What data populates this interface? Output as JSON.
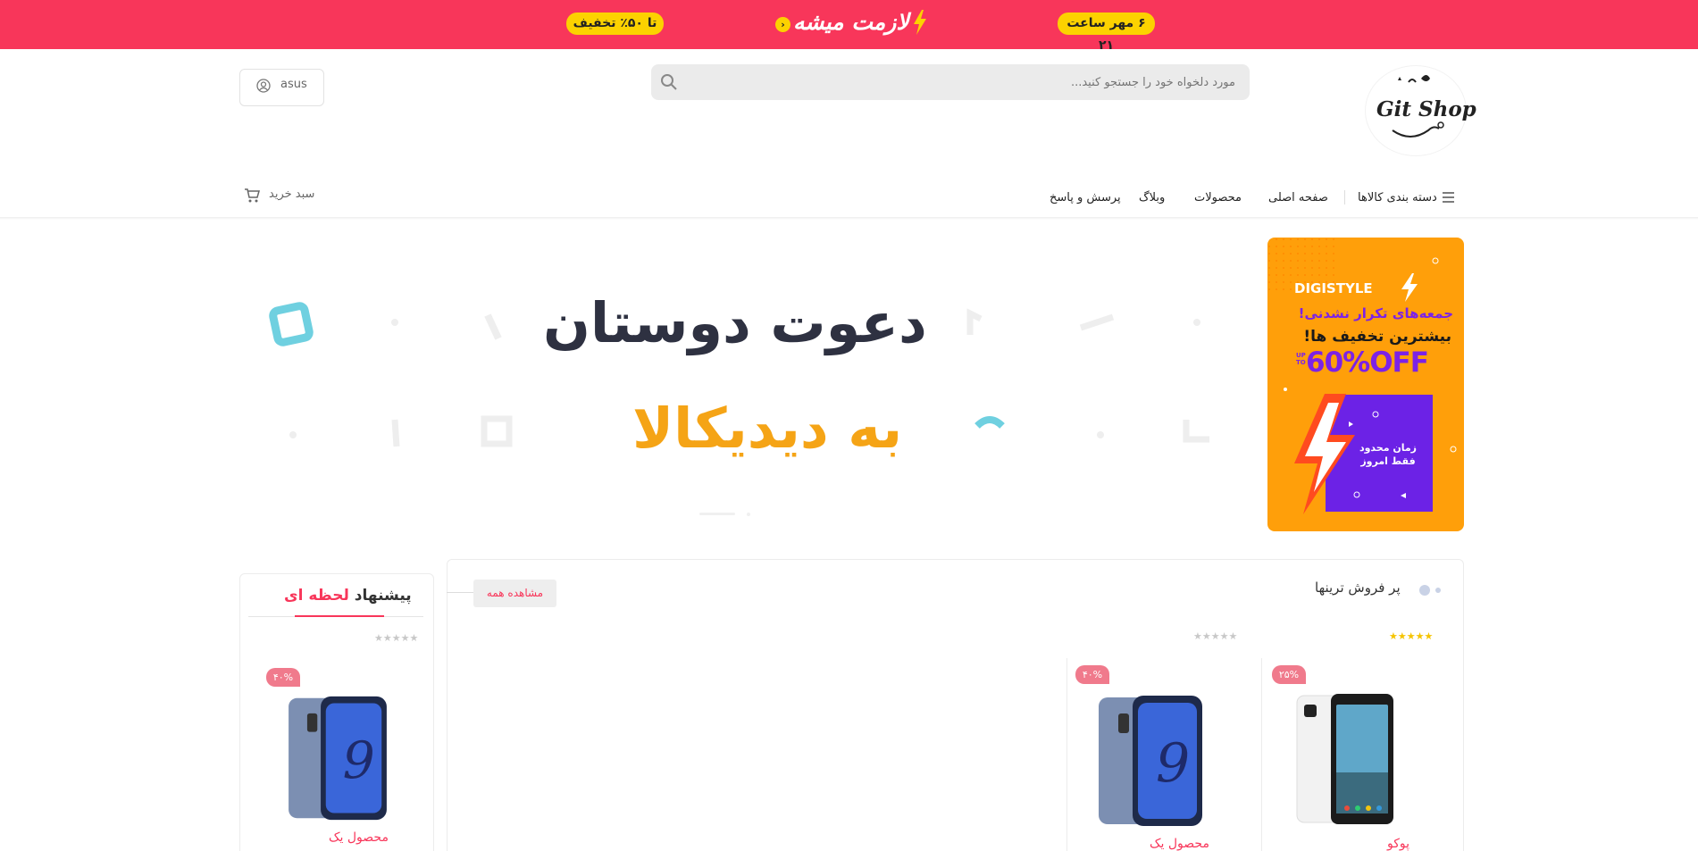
{
  "topbar": {
    "date_pill": "۶ مهر ساعت ۲۱",
    "promo_text": "لازمت میشه",
    "discount_pill": "تا ۵۰٪ تخفیف",
    "bg_color": "#f8365a",
    "pill_color": "#fcd200"
  },
  "header": {
    "logo_text": "Git Shop",
    "search_placeholder": "مورد دلخواه خود را جستجو کنید...",
    "user_name": "asus"
  },
  "nav": {
    "categories": "دسته بندی کالاها",
    "home": "صفحه اصلی",
    "products": "محصولات",
    "blog": "وبلاگ",
    "faq": "پرسش و پاسخ",
    "cart": "سبد خرید"
  },
  "hero": {
    "line1": "دعوت دوستان",
    "line2": "به دیدیکالا"
  },
  "side_banner": {
    "brand": "DIGISTYLE",
    "line1": "جمعه‌های تکرار نشدنی!",
    "line2": "بیشترین تخفیف ها!",
    "upto": "UP TO",
    "off": "60%OFF",
    "box_text": "زمان محدود فقط امروز"
  },
  "best_sellers": {
    "title": "پر فروش ترینها",
    "see_all": "مشاهده همه",
    "products": [
      {
        "name": "پوکو",
        "discount": "۲۵%",
        "rating": 5
      },
      {
        "name": "محصول یک",
        "discount": "۴۰%",
        "rating": 0
      }
    ]
  },
  "deal": {
    "title_dark": "پیشنهاد",
    "title_red": "لحظه ای",
    "product": {
      "name": "محصول یک",
      "discount": "۴۰%",
      "rating": 0
    }
  },
  "colors": {
    "accent": "#f8365a",
    "banner_orange": "#ff9f0a",
    "banner_purple": "#6c22e6",
    "star": "#f5c400"
  }
}
